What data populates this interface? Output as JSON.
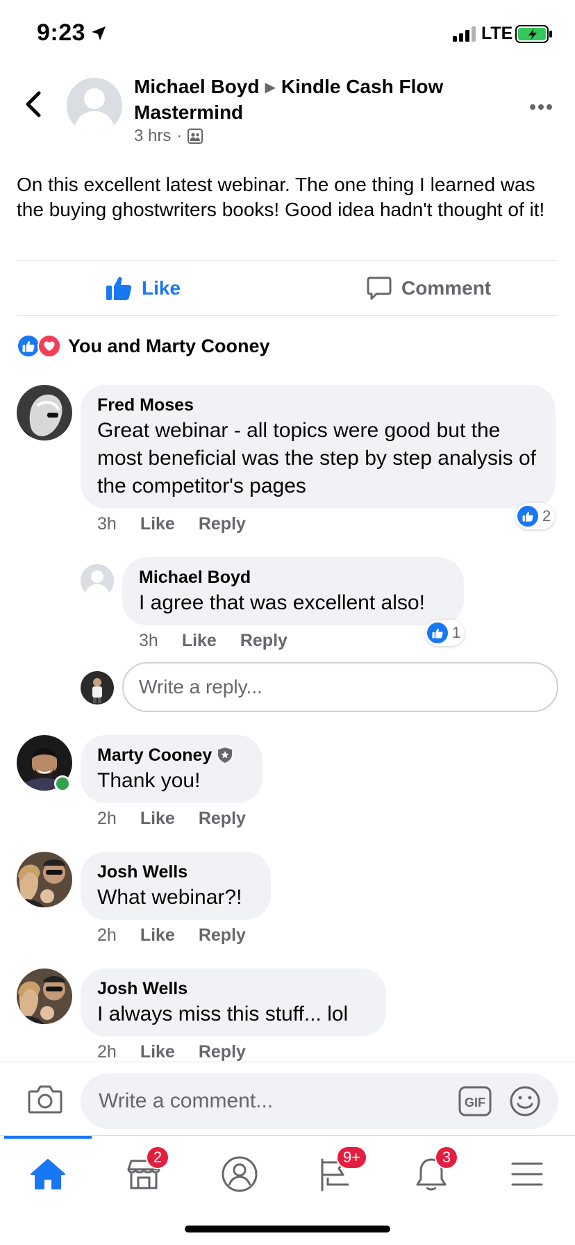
{
  "status_bar": {
    "time": "9:23",
    "network": "LTE"
  },
  "post": {
    "author": "Michael Boyd",
    "group": "Kindle Cash Flow Mastermind",
    "time": "3 hrs",
    "separator": "·",
    "body": "On this excellent latest webinar. The one thing I learned was the buying ghostwriters books! Good idea hadn't thought of it!"
  },
  "actions": {
    "like_label": "Like",
    "comment_label": "Comment"
  },
  "reactions": {
    "summary": "You and Marty Cooney"
  },
  "comments": [
    {
      "name": "Fred Moses",
      "text": "Great webinar - all topics were good but the most beneficial was the step by step analysis of the competitor's pages",
      "time": "3h",
      "like": "Like",
      "reply": "Reply",
      "reaction_count": "2"
    },
    {
      "name": "Michael Boyd",
      "text": "I agree that was excellent also!",
      "time": "3h",
      "like": "Like",
      "reply": "Reply",
      "reaction_count": "1"
    },
    {
      "name": "Marty Cooney",
      "text": "Thank you!",
      "time": "2h",
      "like": "Like",
      "reply": "Reply"
    },
    {
      "name": "Josh Wells",
      "text": "What webinar?!",
      "time": "2h",
      "like": "Like",
      "reply": "Reply"
    },
    {
      "name": "Josh Wells",
      "text": "I always miss this stuff... lol",
      "time": "2h",
      "like": "Like",
      "reply": "Reply"
    }
  ],
  "reply_input": {
    "placeholder": "Write a reply..."
  },
  "composer": {
    "placeholder": "Write a comment...",
    "gif_label": "GIF"
  },
  "tabs": [
    {
      "name": "home",
      "icon": "home-icon",
      "badge": ""
    },
    {
      "name": "marketplace",
      "icon": "marketplace-icon",
      "badge": "2"
    },
    {
      "name": "profile",
      "icon": "profile-icon",
      "badge": ""
    },
    {
      "name": "groups",
      "icon": "flag-icon",
      "badge": "9+"
    },
    {
      "name": "notifications",
      "icon": "bell-icon",
      "badge": "3"
    },
    {
      "name": "menu",
      "icon": "menu-icon",
      "badge": ""
    }
  ],
  "colors": {
    "accent": "#1877f2",
    "bubble": "#f0f2f5",
    "muted": "#65676b",
    "badge": "#e41e3f",
    "love": "#f33e58",
    "online": "#31a24c"
  }
}
